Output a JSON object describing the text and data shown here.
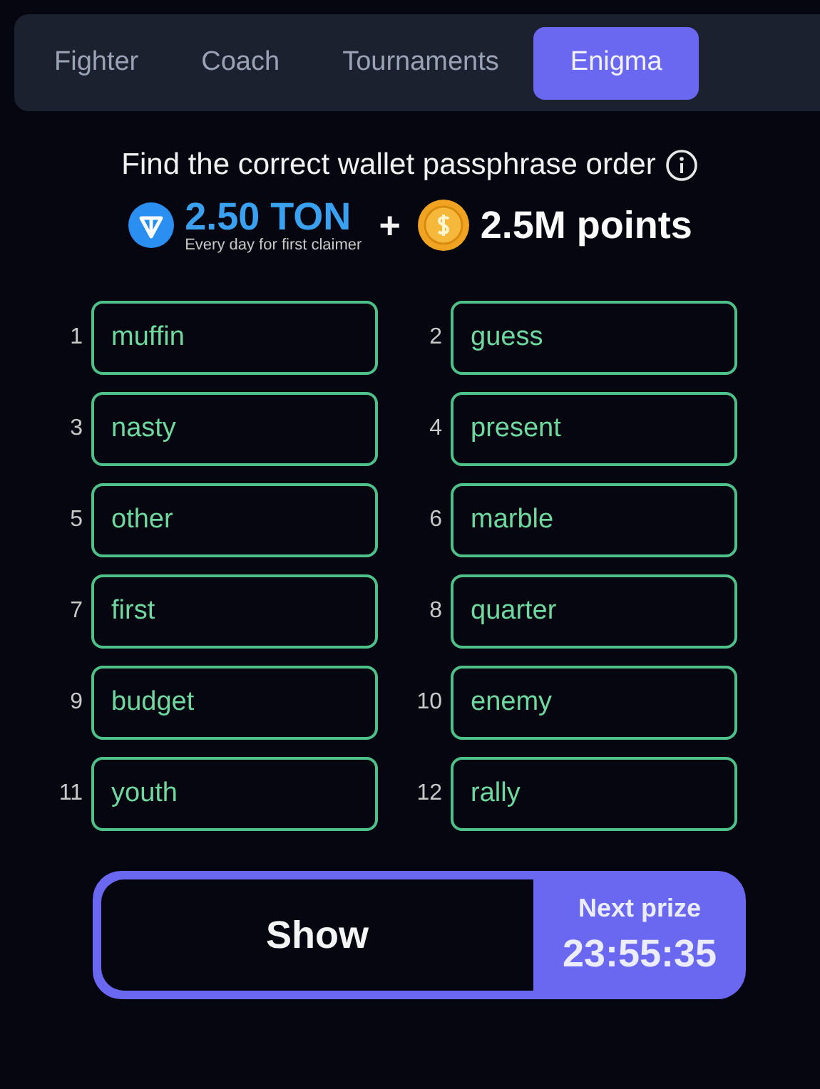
{
  "tabs": [
    {
      "label": "Fighter",
      "selected": false
    },
    {
      "label": "Coach",
      "selected": false
    },
    {
      "label": "Tournaments",
      "selected": false
    },
    {
      "label": "Enigma",
      "selected": true
    }
  ],
  "title": "Find the correct wallet passphrase order",
  "reward": {
    "ton_amount": "2.50 TON",
    "ton_note": "Every day for first claimer",
    "plus": "+",
    "points": "2.5M points"
  },
  "words": [
    {
      "number": "1",
      "word": "muffin"
    },
    {
      "number": "2",
      "word": "guess"
    },
    {
      "number": "3",
      "word": "nasty"
    },
    {
      "number": "4",
      "word": "present"
    },
    {
      "number": "5",
      "word": "other"
    },
    {
      "number": "6",
      "word": "marble"
    },
    {
      "number": "7",
      "word": "first"
    },
    {
      "number": "8",
      "word": "quarter"
    },
    {
      "number": "9",
      "word": "budget"
    },
    {
      "number": "10",
      "word": "enemy"
    },
    {
      "number": "11",
      "word": "youth"
    },
    {
      "number": "12",
      "word": "rally"
    }
  ],
  "action": {
    "button": "Show",
    "timer_label": "Next prize",
    "timer": "23:55:35"
  }
}
